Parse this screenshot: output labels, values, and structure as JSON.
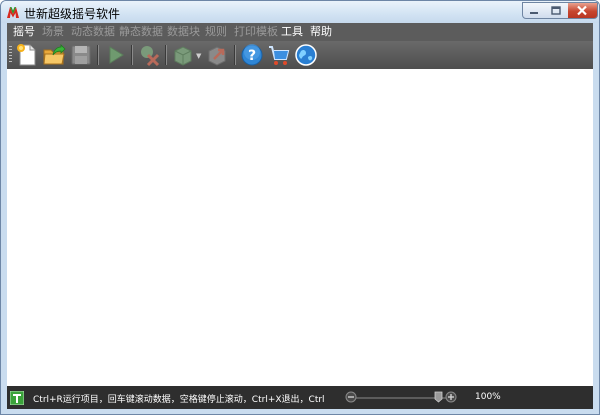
{
  "window": {
    "title": "世新超级摇号软件"
  },
  "menu": {
    "items": [
      {
        "label": "摇号",
        "enabled": true
      },
      {
        "label": "场景",
        "enabled": false
      },
      {
        "label": "动态数据",
        "enabled": false
      },
      {
        "label": "静态数据",
        "enabled": false
      },
      {
        "label": "数据块",
        "enabled": false
      },
      {
        "label": "规则",
        "enabled": false
      },
      {
        "label": "打印模板",
        "enabled": false
      },
      {
        "label": "工具",
        "enabled": true
      },
      {
        "label": "帮助",
        "enabled": true
      }
    ]
  },
  "toolbar": {
    "buttons": [
      {
        "icon": "new-document-icon",
        "enabled": true
      },
      {
        "icon": "open-folder-icon",
        "enabled": true
      },
      {
        "icon": "save-disk-icon",
        "enabled": false
      },
      {
        "icon": "play-icon",
        "enabled": false
      },
      {
        "icon": "delete-icon",
        "enabled": false
      },
      {
        "icon": "print-dropdown-icon",
        "enabled": false
      },
      {
        "icon": "export-icon",
        "enabled": false
      },
      {
        "icon": "help-icon",
        "enabled": true
      },
      {
        "icon": "shopping-cart-icon",
        "enabled": true
      },
      {
        "icon": "globe-icon",
        "enabled": true
      }
    ]
  },
  "status": {
    "hint": "Ctrl+R运行项目，回车键滚动数据，空格键停止滚动，Ctrl+X退出，Ctrl",
    "zoom_percent": "100%",
    "zoom_level": 1.0
  },
  "colors": {
    "menubar_bg": "#5c5c5c",
    "toolbar_bg": "#555555",
    "statusbar_bg": "#2e2e2e",
    "content_bg": "#ffffff",
    "title_bg": "#d2e3f3"
  }
}
